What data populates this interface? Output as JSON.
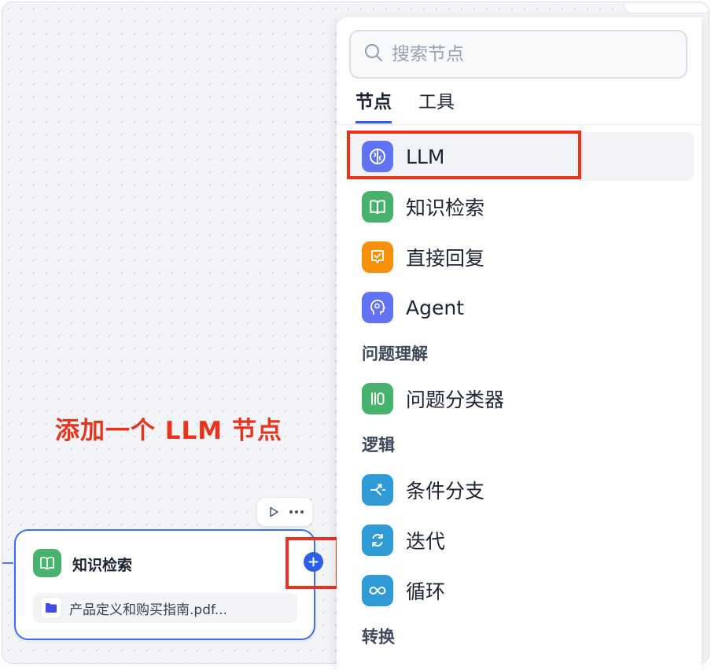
{
  "annotation": "添加一个 LLM 节点",
  "canvas_node": {
    "title": "知识检索",
    "file": "产品定义和购买指南.pdf...",
    "icon": "book-icon",
    "color": "#47b26b"
  },
  "panel": {
    "search_placeholder": "搜索节点",
    "tabs": [
      "节点",
      "工具"
    ],
    "items": {
      "llm": {
        "label": "LLM",
        "icon": "brain-icon",
        "color": "#6172f3"
      },
      "knowledge": {
        "label": "知识检索",
        "icon": "book-icon",
        "color": "#47b26b"
      },
      "reply": {
        "label": "直接回复",
        "icon": "reply-icon",
        "color": "#f79009"
      },
      "agent": {
        "label": "Agent",
        "icon": "agent-icon",
        "color": "#6172f3"
      },
      "classifier": {
        "label": "问题分类器",
        "icon": "classifier-icon",
        "color": "#47b26b"
      },
      "ifelse": {
        "label": "条件分支",
        "icon": "branch-icon",
        "color": "#2e9bd6"
      },
      "iteration": {
        "label": "迭代",
        "icon": "iteration-icon",
        "color": "#2e9bd6"
      },
      "loop": {
        "label": "循环",
        "icon": "loop-icon",
        "color": "#2e9bd6"
      }
    },
    "sections": {
      "understanding": "问题理解",
      "logic": "逻辑",
      "transform": "转换"
    }
  },
  "colors": {
    "accent": "#2c5fe8",
    "highlight": "#e8341c"
  }
}
